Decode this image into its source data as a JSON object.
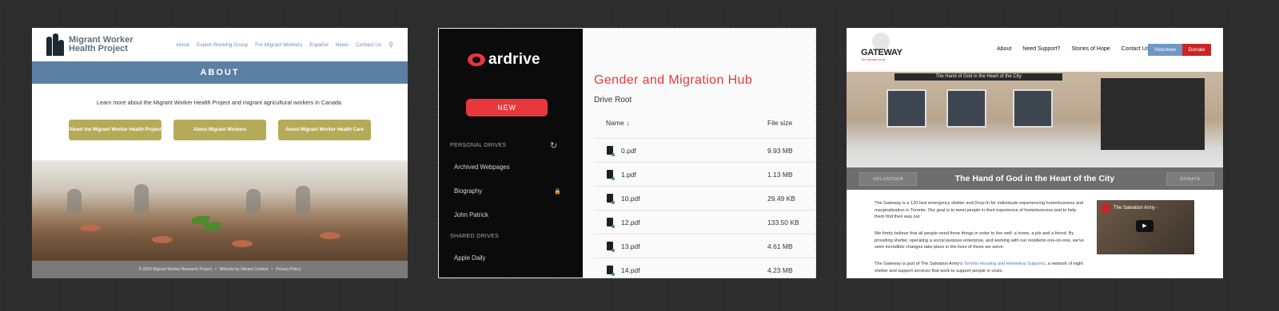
{
  "panel1": {
    "logo_text": "Migrant Worker Health Project",
    "nav": [
      "About",
      "Expert Working Group",
      "For Migrant Workers",
      "Español",
      "News",
      "Contact Us"
    ],
    "band_title": "ABOUT",
    "intro": "Learn more about the Migrant Worker Health Project and migrant agricultural workers in Canada.",
    "buttons": [
      "About the Migrant Worker Health Project",
      "About Migrant Workers",
      "About Migrant Worker Health Care"
    ],
    "footer": [
      "© 2020 Migrant Worker Research Project",
      "•",
      "Website by Vibrant Content",
      "•",
      "Privacy Policy"
    ]
  },
  "panel2": {
    "logo": "ardrive",
    "new_button": "NEW",
    "personal_drives_label": "PERSONAL DRIVES",
    "personal_drives": [
      "Archived Webpages",
      "Biography",
      "John Patrick"
    ],
    "shared_drives_label": "SHARED DRIVES",
    "shared_drives": [
      "Apple Daily"
    ],
    "title": "Gender and Migration Hub",
    "subtitle": "Drive Root",
    "col_name": "Name",
    "col_name_sort_icon": "↓",
    "col_size": "File size",
    "files": [
      {
        "name": "0.pdf",
        "size": "9.93 MB"
      },
      {
        "name": "1.pdf",
        "size": "1.13 MB"
      },
      {
        "name": "10.pdf",
        "size": "29.49 KB"
      },
      {
        "name": "12.pdf",
        "size": "133.50 KB"
      },
      {
        "name": "13.pdf",
        "size": "4.61 MB"
      },
      {
        "name": "14.pdf",
        "size": "4.23 MB"
      }
    ]
  },
  "panel3": {
    "logo": "GATEWAY",
    "logo_sub": "The Salvation Army",
    "nav": [
      "About",
      "Need Support?",
      "Stories of Hope",
      "Contact Us"
    ],
    "volunteer": "Volunteer",
    "donate": "Donate",
    "sign_text": "The Hand of God in the Heart of the City",
    "bar_title": "The Hand of God in the Heart of the City",
    "bar_volunteer": "VOLUNTEER",
    "bar_donate": "DONATE",
    "para1": "The Gateway is a 120 bed emergency shelter and Drop-In for individuals experiencing homelessness and marginalization in Toronto. Our goal is to meet people in their experience of homelessness and to help them find their way out.",
    "para2": "We firmly believe that all people need three things in order to live well: a home, a job and a friend. By providing shelter, operating a social purpose enterprise, and working with our residents one-on-one, we've seen incredible changes take place in the lives of those we serve.",
    "para3_a": "The Gateway is part of The Salvation Army's ",
    "para3_link": "Toronto Housing and Homeless Supports",
    "para3_b": ", a network of eight shelter and support services that work to support people in crisis.",
    "video_title": "The Salvation Army -"
  }
}
